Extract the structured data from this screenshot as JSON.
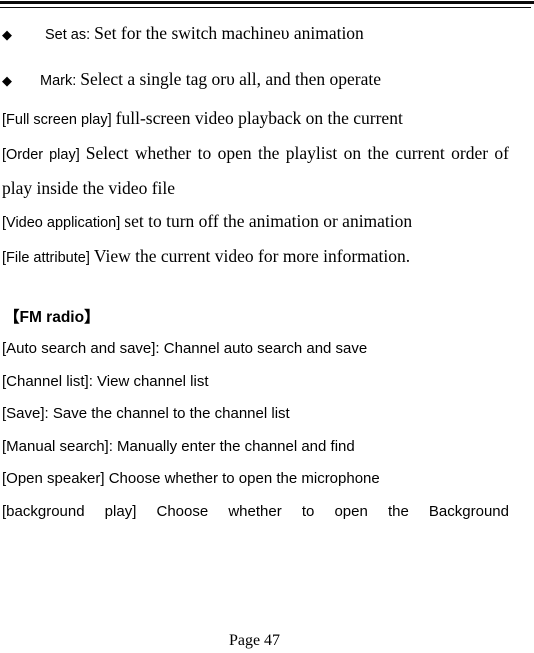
{
  "page": {
    "number_label": "Page 47",
    "top_rule_count": 2
  },
  "bullets": [
    {
      "marker": "◆",
      "lead": "Set as:",
      "rest": "Set for the switch machineυ animation"
    },
    {
      "marker": "◆",
      "lead": "Mark:",
      "rest": "Select a single tag orυ all, and then operate"
    }
  ],
  "video_settings": [
    {
      "tag": "[Full screen play]",
      "text": "full-screen video playback on the current"
    },
    {
      "tag": "[Order play]",
      "text": "Select whether to open the playlist on the current order of play inside the video file"
    },
    {
      "tag": "[Video application]",
      "text": "set to turn off the animation or animation"
    },
    {
      "tag": "[File attribute]",
      "text": "View the current video for more information."
    }
  ],
  "fm_radio": {
    "heading": "【FM radio】",
    "items": [
      "[Auto search and save]: Channel auto search and save",
      "[Channel list]: View channel list",
      "[Save]: Save the channel to the channel list",
      "[Manual search]: Manually enter the channel and find",
      "[Open speaker] Choose whether to open the microphone",
      "[background play] Choose whether to open the Background"
    ]
  }
}
